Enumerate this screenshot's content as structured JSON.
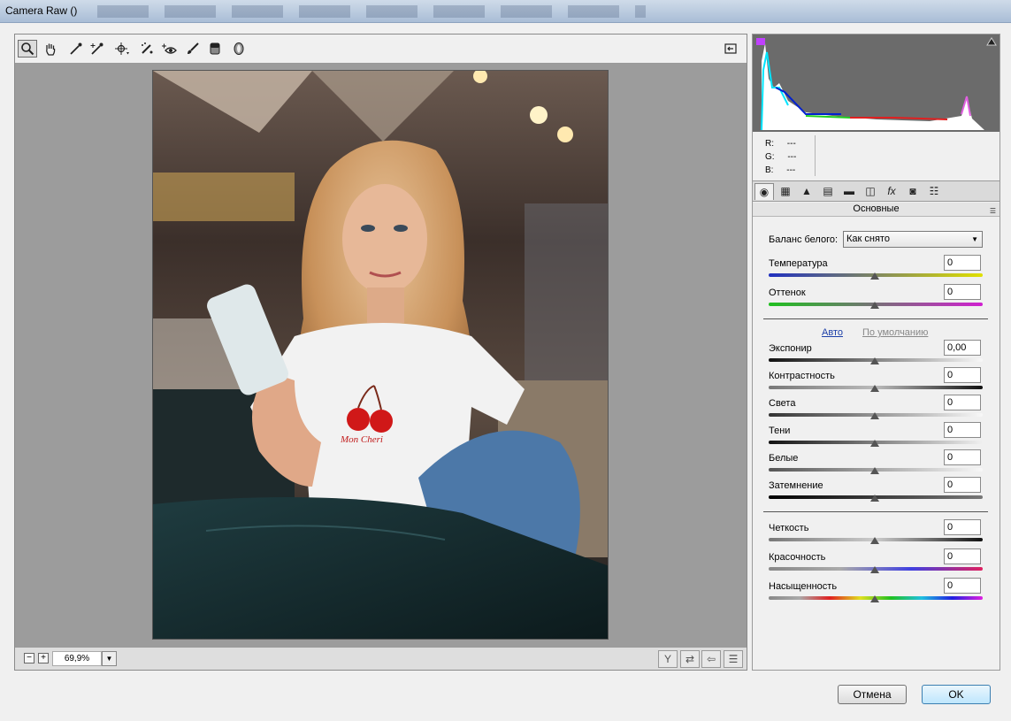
{
  "window": {
    "title": "Camera Raw ()"
  },
  "tools": [
    {
      "name": "zoom-tool",
      "glyph": "🔍"
    },
    {
      "name": "hand-tool",
      "glyph": "✋"
    },
    {
      "name": "white-balance-tool",
      "glyph": "✒"
    },
    {
      "name": "color-sampler-tool",
      "glyph": "✑"
    },
    {
      "name": "targeted-adjustment-tool",
      "glyph": "⌖"
    },
    {
      "name": "spot-removal-tool",
      "glyph": "✎"
    },
    {
      "name": "red-eye-tool",
      "glyph": "👁"
    },
    {
      "name": "adjustment-brush-tool",
      "glyph": "🖌"
    },
    {
      "name": "graduated-filter-tool",
      "glyph": "▯"
    },
    {
      "name": "radial-filter-tool",
      "glyph": "◯"
    }
  ],
  "statusbar": {
    "zoom": "69,9%"
  },
  "rgb_readout": {
    "r_label": "R:",
    "g_label": "G:",
    "b_label": "B:",
    "r": "---",
    "g": "---",
    "b": "---"
  },
  "panel": {
    "section_title": "Основные",
    "white_balance": {
      "label": "Баланс белого:",
      "value": "Как снято"
    },
    "auto_link": "Авто",
    "default_link": "По умолчанию",
    "sliders": [
      {
        "key": "temperature",
        "label": "Температура",
        "value": "0"
      },
      {
        "key": "tint",
        "label": "Оттенок",
        "value": "0"
      },
      {
        "key": "exposure",
        "label": "Экспонир",
        "value": "0,00"
      },
      {
        "key": "contrast",
        "label": "Контрастность",
        "value": "0"
      },
      {
        "key": "highlights",
        "label": "Света",
        "value": "0"
      },
      {
        "key": "shadows",
        "label": "Тени",
        "value": "0"
      },
      {
        "key": "whites",
        "label": "Белые",
        "value": "0"
      },
      {
        "key": "blacks",
        "label": "Затемнение",
        "value": "0"
      },
      {
        "key": "clarity",
        "label": "Четкость",
        "value": "0"
      },
      {
        "key": "vibrance",
        "label": "Красочность",
        "value": "0"
      },
      {
        "key": "saturation",
        "label": "Насыщенность",
        "value": "0"
      }
    ]
  },
  "buttons": {
    "cancel": "Отмена",
    "ok": "OK"
  },
  "colors": {
    "ok_border": "#3c7fb1",
    "accent_link": "#1c3fa8"
  }
}
